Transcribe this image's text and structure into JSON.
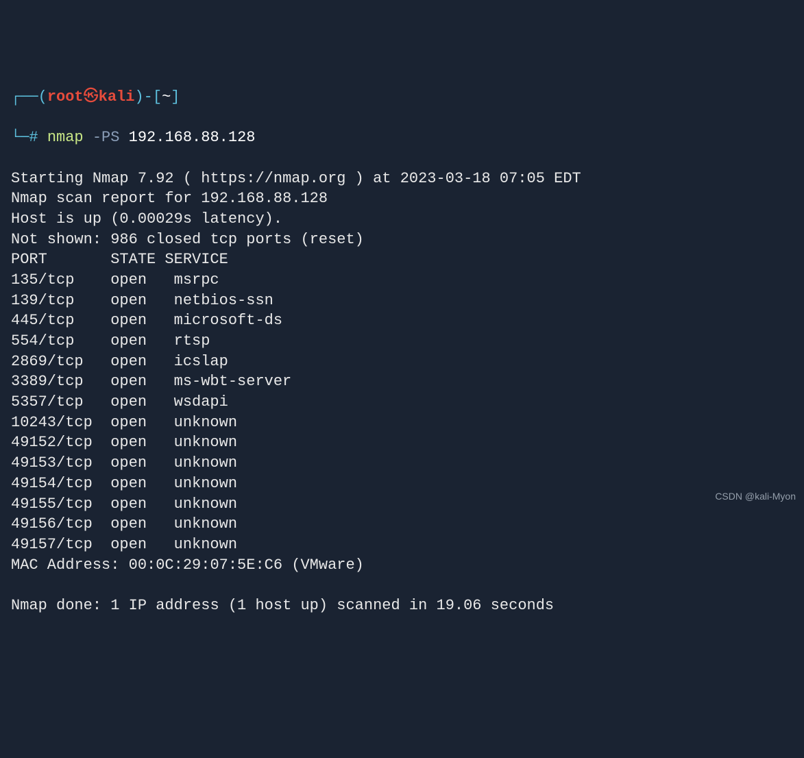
{
  "prompt": {
    "user": "root",
    "host": "kali",
    "symbol": "#",
    "cwd": "~"
  },
  "command": {
    "bin": "nmap",
    "flag": "-PS",
    "target": "192.168.88.128"
  },
  "output": {
    "starting": "Starting Nmap 7.92 ( https://nmap.org ) at 2023-03-18 07:05 EDT",
    "report": "Nmap scan report for 192.168.88.128",
    "hostup": "Host is up (0.00029s latency).",
    "notshown": "Not shown: 986 closed tcp ports (reset)",
    "header": {
      "port": "PORT",
      "state": "STATE",
      "service": "SERVICE"
    },
    "ports": [
      {
        "port": "135/tcp",
        "state": "open",
        "service": "msrpc"
      },
      {
        "port": "139/tcp",
        "state": "open",
        "service": "netbios-ssn"
      },
      {
        "port": "445/tcp",
        "state": "open",
        "service": "microsoft-ds"
      },
      {
        "port": "554/tcp",
        "state": "open",
        "service": "rtsp"
      },
      {
        "port": "2869/tcp",
        "state": "open",
        "service": "icslap"
      },
      {
        "port": "3389/tcp",
        "state": "open",
        "service": "ms-wbt-server"
      },
      {
        "port": "5357/tcp",
        "state": "open",
        "service": "wsdapi"
      },
      {
        "port": "10243/tcp",
        "state": "open",
        "service": "unknown"
      },
      {
        "port": "49152/tcp",
        "state": "open",
        "service": "unknown"
      },
      {
        "port": "49153/tcp",
        "state": "open",
        "service": "unknown"
      },
      {
        "port": "49154/tcp",
        "state": "open",
        "service": "unknown"
      },
      {
        "port": "49155/tcp",
        "state": "open",
        "service": "unknown"
      },
      {
        "port": "49156/tcp",
        "state": "open",
        "service": "unknown"
      },
      {
        "port": "49157/tcp",
        "state": "open",
        "service": "unknown"
      }
    ],
    "mac": "MAC Address: 00:0C:29:07:5E:C6 (VMware)",
    "done": "Nmap done: 1 IP address (1 host up) scanned in 19.06 seconds"
  },
  "watermark": "CSDN @kali-Myon"
}
